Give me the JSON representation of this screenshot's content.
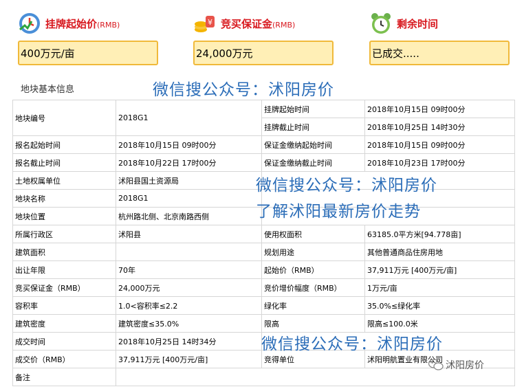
{
  "cards": [
    {
      "title": "挂牌起始价",
      "suffix": "(RMB)",
      "value": "400万元/亩",
      "icon": "price-icon"
    },
    {
      "title": "竞买保证金",
      "suffix": "(RMB)",
      "value": "24,000万元",
      "icon": "deposit-icon"
    },
    {
      "title": "剩余时间",
      "suffix": "",
      "value": "已成交.....",
      "icon": "alarm-clock-icon"
    }
  ],
  "section_title": "地块基本信息",
  "rows": [
    [
      "地块编号",
      "2018G1",
      "挂牌起始时间",
      "2018年10月15日 09时00分"
    ],
    [
      "",
      "",
      "挂牌截止时间",
      "2018年10月25日 14时30分"
    ],
    [
      "报名起始时间",
      "2018年10月15日 09时00分",
      "保证金缴纳起始时间",
      "2018年10月15日 09时00分"
    ],
    [
      "报名截止时间",
      "2018年10月22日 17时00分",
      "保证金缴纳截止时间",
      "2018年10月23日 17时00分"
    ],
    [
      "土地权属单位",
      "沭阳县国土资源局",
      "",
      ""
    ],
    [
      "地块名称",
      "2018G1",
      "",
      ""
    ],
    [
      "地块位置",
      "杭州路北侧、北京南路西侧",
      "",
      ""
    ],
    [
      "所属行政区",
      "沭阳县",
      "使用权面积",
      "63185.0平方米[94.778亩]"
    ],
    [
      "建筑面积",
      "",
      "规划用途",
      "其他普通商品住房用地"
    ],
    [
      "出让年限",
      "70年",
      "起始价（RMB）",
      "37,911万元 [400万元/亩]"
    ],
    [
      "竞买保证金（RMB）",
      "24,000万元",
      "竞价增价幅度（RMB）",
      "1万元/亩"
    ],
    [
      "容积率",
      "1.0<容积率≤2.2",
      "绿化率",
      "35.0%≤绿化率"
    ],
    [
      "建筑密度",
      "建筑密度≤35.0%",
      "限高",
      "限高≤100.0米"
    ],
    [
      "成交时间",
      "2018年10月25日 14时34分",
      "",
      ""
    ],
    [
      "成交价（RMB）",
      "37,911万元 [400万元/亩]",
      "竞得单位",
      "沭阳明航置业有限公司"
    ],
    [
      "备注",
      "",
      "",
      ""
    ]
  ],
  "watermarks": {
    "wm1": "微信搜公众号：沭阳房价",
    "wm2": "微信搜公众号：沭阳房价",
    "wm3": "了解沭阳最新房价走势",
    "wm4": "微信搜公众号：沭阳房价",
    "brand": "沭阳房价"
  }
}
